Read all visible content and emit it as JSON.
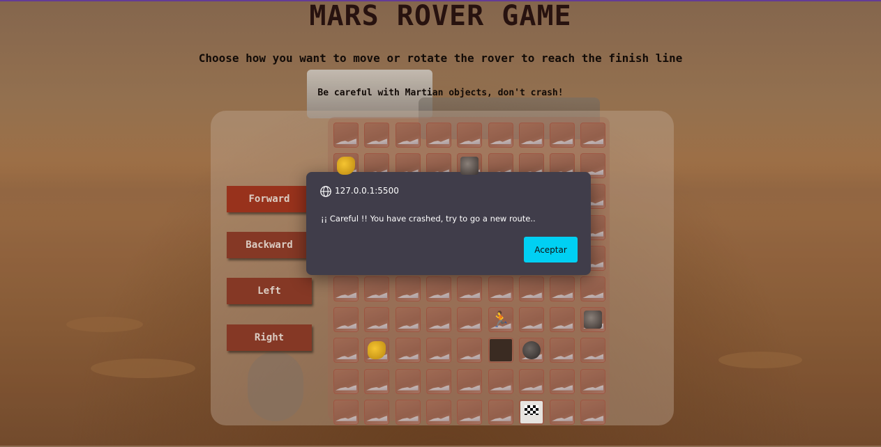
{
  "header": {
    "title": "MARS ROVER GAME",
    "instructions": "Choose how you want to move or rotate the rover to reach the finish line",
    "warning": "Be careful with Martian objects, don't crash!"
  },
  "controls": {
    "forward": "Forward",
    "backward": "Backward",
    "left": "Left",
    "right": "Right"
  },
  "board": {
    "rows": 10,
    "cols": 9,
    "objects": [
      {
        "row": 1,
        "col": 0,
        "type": "gold-nugget"
      },
      {
        "row": 1,
        "col": 4,
        "type": "robot"
      },
      {
        "row": 6,
        "col": 5,
        "type": "alien"
      },
      {
        "row": 6,
        "col": 8,
        "type": "robot"
      },
      {
        "row": 7,
        "col": 1,
        "type": "gold-nugget"
      },
      {
        "row": 7,
        "col": 5,
        "type": "sign"
      },
      {
        "row": 7,
        "col": 6,
        "type": "rock"
      },
      {
        "row": 9,
        "col": 6,
        "type": "finish-flag"
      }
    ]
  },
  "dialog": {
    "origin": "127.0.0.1:5500",
    "message": "¡¡ Careful !! You have crashed, try to go a new route..",
    "ok_label": "Aceptar",
    "accent_color": "#00d0f3"
  }
}
